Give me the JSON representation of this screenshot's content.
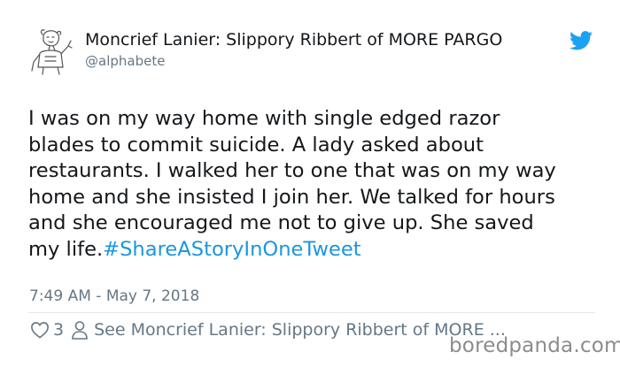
{
  "author": {
    "display_name": "Moncrief Lanier: Slippory Ribbert of MORE PARGO",
    "handle": "@alphabete"
  },
  "tweet": {
    "text": "I was on my way home with single edged razor\nblades to commit suicide. A lady asked about\nrestaurants. I walked her to one that was on my way\nhome and she insisted I join her. We talked for hours\nand she encouraged me not to give up. She saved\nmy life.",
    "hashtag": "#ShareAStoryInOneTweet",
    "timestamp": "7:49 AM - May 7, 2018"
  },
  "actions": {
    "like_count": "3",
    "see_more_label": "See Moncrief Lanier: Slippory Ribbert of MORE ..."
  },
  "watermark": "boredpanda.com",
  "colors": {
    "link": "#1b95e0",
    "muted": "#657786",
    "text": "#14171a",
    "twitter_blue": "#1da1f2"
  }
}
